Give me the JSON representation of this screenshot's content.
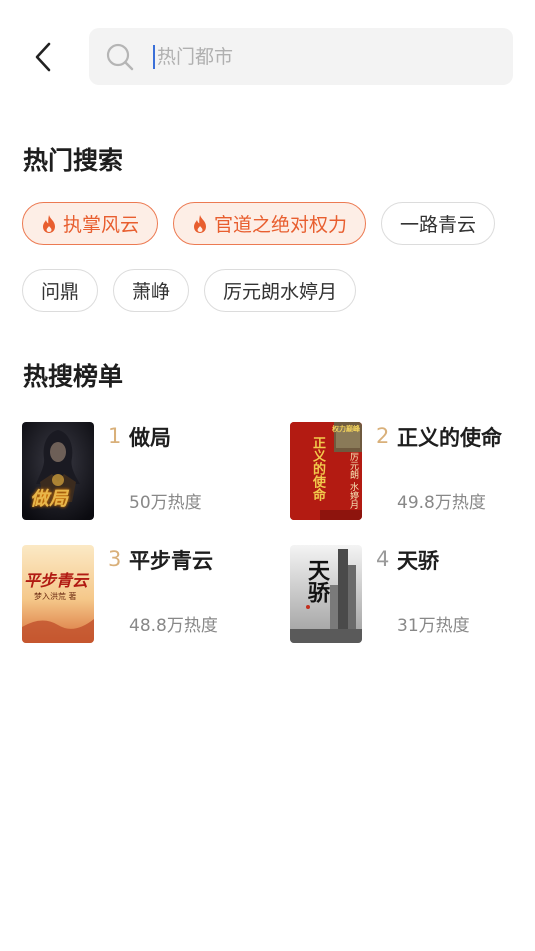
{
  "search": {
    "placeholder": "热门都市"
  },
  "hot_search": {
    "title": "热门搜索",
    "tags": [
      {
        "label": "执掌风云",
        "hot": true
      },
      {
        "label": "官道之绝对权力",
        "hot": true
      },
      {
        "label": "一路青云",
        "hot": false
      },
      {
        "label": "问鼎",
        "hot": false
      },
      {
        "label": "萧峥",
        "hot": false
      },
      {
        "label": "厉元朗水婷月",
        "hot": false
      }
    ]
  },
  "ranking": {
    "title": "热搜榜单",
    "items": [
      {
        "rank": "1",
        "title": "做局",
        "heat": "50万热度",
        "cover_text": "做局"
      },
      {
        "rank": "2",
        "title": "正义的使命",
        "heat": "49.8万热度",
        "cover_text": "正义的使命",
        "cover_author": "厉元朗 水婷月",
        "cover_badge": "权力巅峰"
      },
      {
        "rank": "3",
        "title": "平步青云",
        "heat": "48.8万热度",
        "cover_text": "平步青云",
        "cover_author": "梦入洪荒 著"
      },
      {
        "rank": "4",
        "title": "天骄",
        "heat": "31万热度",
        "cover_text": "天骄"
      }
    ]
  },
  "colors": {
    "accent": "#e85e2f",
    "accent_bg": "#fdeee6",
    "rank_gold": "#d9b07a",
    "rank_gray": "#9a9a9a"
  }
}
